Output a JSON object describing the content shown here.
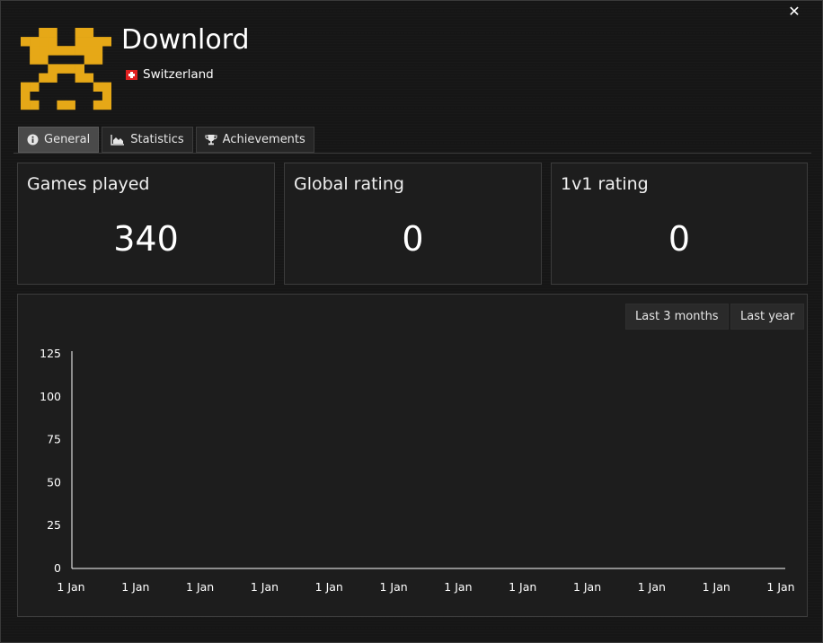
{
  "window": {
    "close_icon": "close-icon"
  },
  "profile": {
    "name": "Downlord",
    "country": "Switzerland",
    "flag_icon": "swiss-flag-icon",
    "avatar_color": "#e6a817"
  },
  "tabs": [
    {
      "label": "General",
      "icon": "info-icon",
      "active": true
    },
    {
      "label": "Statistics",
      "icon": "area-chart-icon",
      "active": false
    },
    {
      "label": "Achievements",
      "icon": "trophy-icon",
      "active": false
    }
  ],
  "stats": {
    "games_played": {
      "title": "Games played",
      "value": "340"
    },
    "global_rating": {
      "title": "Global rating",
      "value": "0"
    },
    "ladder_rating": {
      "title": "1v1 rating",
      "value": "0"
    }
  },
  "range_buttons": {
    "last_3_months": "Last 3 months",
    "last_year": "Last year"
  },
  "chart_data": {
    "type": "line",
    "title": "",
    "xlabel": "",
    "ylabel": "",
    "ylim": [
      0,
      125
    ],
    "y_ticks": [
      "125",
      "100",
      "75",
      "50",
      "25",
      "0"
    ],
    "x_ticks": [
      "1 Jan",
      "1 Jan",
      "1 Jan",
      "1 Jan",
      "1 Jan",
      "1 Jan",
      "1 Jan",
      "1 Jan",
      "1 Jan",
      "1 Jan",
      "1 Jan",
      "1 Jan"
    ],
    "series": [],
    "grid": false
  }
}
